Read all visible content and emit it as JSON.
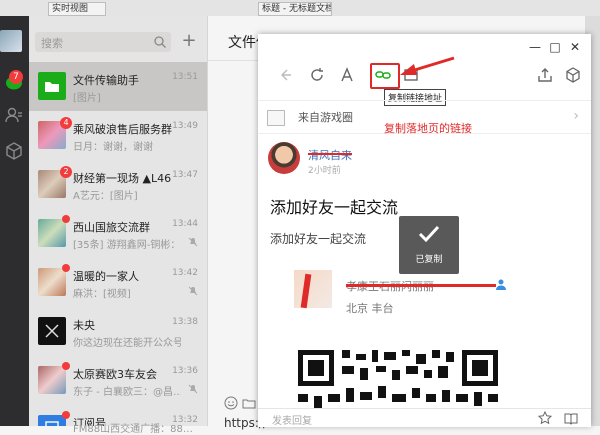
{
  "top_strip": {
    "tabs": [
      "实时视图",
      "标题 - 无标题文档"
    ]
  },
  "nav": {
    "unread_badge": "7"
  },
  "conversations": {
    "search_placeholder": "搜索",
    "add_label": "+",
    "items": [
      {
        "name": "文件传输助手",
        "time": "13:51",
        "preview": "[图片]",
        "badge": "",
        "dot": false,
        "muted": false
      },
      {
        "name": "乘风破浪售后服务群",
        "time": "13:49",
        "preview": "日月：谢谢，谢谢",
        "badge": "4",
        "dot": false,
        "muted": false
      },
      {
        "name": "财经第一现场 ▲L46",
        "time": "13:47",
        "preview": "A艺元：[图片]",
        "badge": "2",
        "dot": false,
        "muted": false
      },
      {
        "name": "西山国旅交流群",
        "time": "13:44",
        "preview": "[35条] 游翔鑫网-铜彬：…",
        "badge": "",
        "dot": true,
        "muted": true
      },
      {
        "name": "温暖的一家人",
        "time": "13:42",
        "preview": "麻洪：[视频]",
        "badge": "",
        "dot": true,
        "muted": true
      },
      {
        "name": "未央",
        "time": "13:38",
        "preview": "你这边现在还能开公众号…",
        "badge": "",
        "dot": false,
        "muted": false
      },
      {
        "name": "太原赛欧3车友会",
        "time": "13:36",
        "preview": "东子 - 白襄欧三：@昌…",
        "badge": "",
        "dot": true,
        "muted": true
      },
      {
        "name": "订阅号",
        "time": "13:32",
        "preview": "FM88山西交通广播：88…",
        "badge": "",
        "dot": true,
        "muted": false
      }
    ]
  },
  "chat": {
    "title": "文件传输助手",
    "input_text": "https://"
  },
  "popup": {
    "window_controls": [
      "—",
      "□",
      "✕"
    ],
    "tooltip": "复制链接地址",
    "source_text": "来自游戏圈",
    "annotation": "复制落地页的链接",
    "author_name": "清风自来",
    "post_time": "2小时前",
    "title": "添加好友一起交流",
    "body": "添加好友一起交流",
    "copied_label": "已复制",
    "card_name": "孝康王石丽闪丽丽",
    "card_location": "北京 丰台",
    "comment_placeholder": "发表回复"
  },
  "colors": {
    "accent_red": "#e02a2a",
    "wechat_green": "#1aad19",
    "nav_dark": "#2d2c2e"
  }
}
